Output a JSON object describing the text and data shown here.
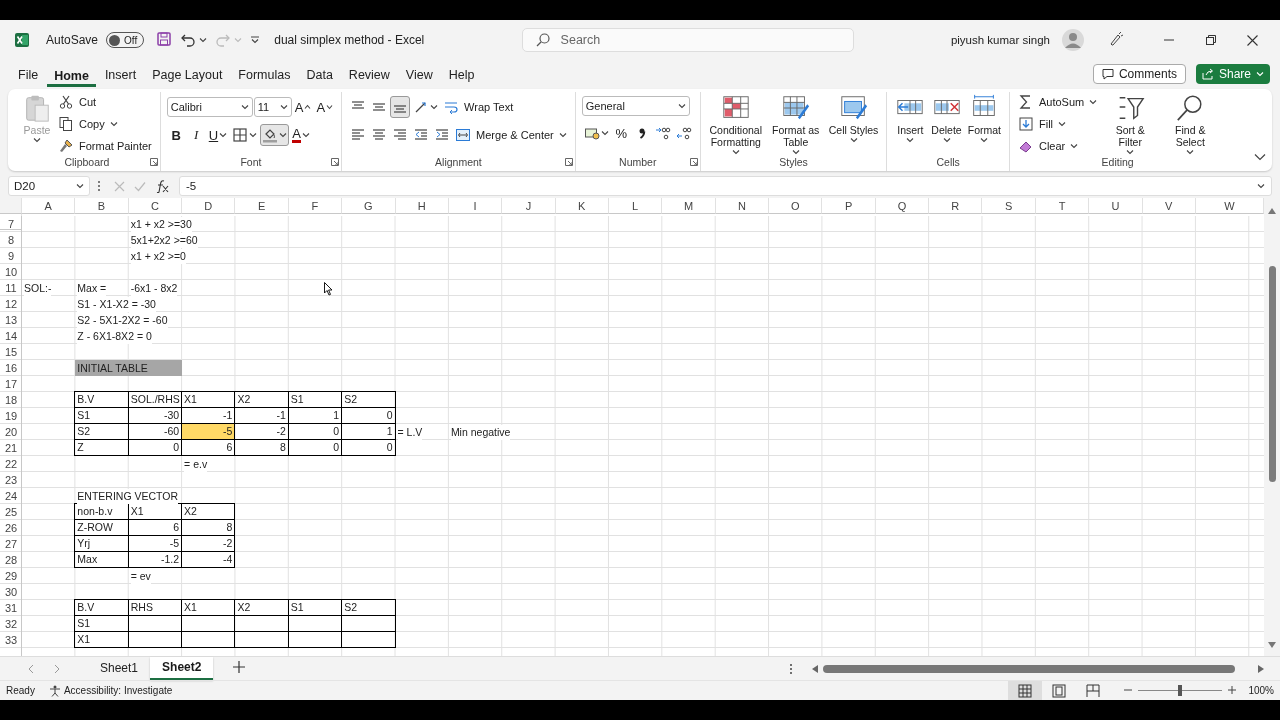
{
  "title_bar": {
    "autosave": {
      "label": "AutoSave",
      "on": false,
      "state_text": "Off"
    },
    "document_title": "dual simplex method  -  Excel",
    "search_placeholder": "Search",
    "user_name": "piyush kumar singh"
  },
  "menu_tabs": [
    {
      "label": "File",
      "selected": false
    },
    {
      "label": "Home",
      "selected": true
    },
    {
      "label": "Insert",
      "selected": false
    },
    {
      "label": "Page Layout",
      "selected": false
    },
    {
      "label": "Formulas",
      "selected": false
    },
    {
      "label": "Data",
      "selected": false
    },
    {
      "label": "Review",
      "selected": false
    },
    {
      "label": "View",
      "selected": false
    },
    {
      "label": "Help",
      "selected": false
    }
  ],
  "comments_button": "Comments",
  "share_button": "Share",
  "ribbon": [
    {
      "label": "Clipboard",
      "stacks": [
        [
          {
            "kind": "large",
            "label": "Paste",
            "disabled": true
          }
        ],
        [
          {
            "kind": "small",
            "label": "Cut",
            "disabled": false
          },
          {
            "kind": "small",
            "label": "Copy",
            "disabled": false
          },
          {
            "kind": "small",
            "label": "Format Painter",
            "disabled": false
          }
        ]
      ]
    },
    {
      "label": "Font",
      "upper_row": [
        {
          "kind": "field",
          "value": "Calibri"
        },
        {
          "kind": "field",
          "value": "11"
        },
        {
          "kind": "tool",
          "label": "A",
          "selected": false
        },
        {
          "kind": "tool",
          "label": "A",
          "selected": false
        }
      ],
      "lower_row": [
        {
          "kind": "tool",
          "label": "B",
          "selected": false
        },
        {
          "kind": "tool",
          "label": "I",
          "selected": false
        },
        {
          "kind": "tool",
          "label": "U",
          "selected": false
        },
        {
          "kind": "tool",
          "selected": false
        },
        {
          "kind": "tool",
          "selected": true
        },
        {
          "kind": "tool",
          "label": "A",
          "selected": false
        }
      ]
    },
    {
      "label": "Alignment",
      "upper_row": [
        {
          "kind": "tool",
          "selected": false
        },
        {
          "kind": "tool",
          "selected": false
        },
        {
          "kind": "tool",
          "selected": true
        },
        {
          "kind": "tool",
          "selected": false
        },
        {
          "kind": "small",
          "label": "Wrap Text"
        }
      ],
      "lower_row": [
        {
          "kind": "tool",
          "selected": false
        },
        {
          "kind": "tool",
          "selected": false
        },
        {
          "kind": "tool",
          "selected": false
        },
        {
          "kind": "tool",
          "selected": false
        },
        {
          "kind": "tool",
          "selected": false
        },
        {
          "kind": "small",
          "label": "Merge & Center"
        }
      ]
    },
    {
      "label": "Number",
      "upper_row": [
        {
          "kind": "field",
          "value": "General"
        }
      ],
      "lower_row": [
        {
          "kind": "tool",
          "selected": false
        },
        {
          "kind": "tool",
          "label": "%",
          "selected": false
        },
        {
          "kind": "tool",
          "selected": false
        },
        {
          "kind": "tool",
          "selected": false
        },
        {
          "kind": "tool",
          "selected": false
        }
      ]
    },
    {
      "label": "Styles",
      "stacks": [
        [
          {
            "kind": "large",
            "label": "Conditional Formatting"
          }
        ],
        [
          {
            "kind": "large",
            "label": "Format as Table"
          }
        ],
        [
          {
            "kind": "large",
            "label": "Cell Styles"
          }
        ]
      ]
    },
    {
      "label": "Cells",
      "stacks": [
        [
          {
            "kind": "large",
            "label": "Insert"
          }
        ],
        [
          {
            "kind": "large",
            "label": "Delete"
          }
        ],
        [
          {
            "kind": "large",
            "label": "Format"
          }
        ]
      ]
    },
    {
      "label": "Editing",
      "stacks": [
        [
          {
            "kind": "small",
            "label": "AutoSum"
          },
          {
            "kind": "small",
            "label": "Fill"
          },
          {
            "kind": "small",
            "label": "Clear"
          }
        ],
        [
          {
            "kind": "large",
            "label": "Sort & Filter"
          }
        ],
        [
          {
            "kind": "large",
            "label": "Find & Select"
          }
        ]
      ]
    }
  ],
  "formula_bar": {
    "name_box": "D20",
    "formula": "-5"
  },
  "grid": {
    "columns": [
      "A",
      "B",
      "C",
      "D",
      "E",
      "F",
      "G",
      "H",
      "I",
      "J",
      "K",
      "L",
      "M",
      "N",
      "O",
      "P",
      "Q",
      "R",
      "S",
      "T",
      "U",
      "V",
      "W"
    ],
    "rows": [
      {
        "num": "7",
        "cells": [
          {
            "kind": "blank",
            "bordered": false
          },
          {
            "kind": "blank",
            "bordered": false
          },
          {
            "kind": "text",
            "text": "x1 + x2 >=30",
            "bordered": false
          }
        ]
      },
      {
        "num": "8",
        "cells": [
          {
            "kind": "blank",
            "bordered": false
          },
          {
            "kind": "blank",
            "bordered": false
          },
          {
            "kind": "text",
            "text": "5x1+2x2 >=60",
            "bordered": false
          }
        ]
      },
      {
        "num": "9",
        "cells": [
          {
            "kind": "blank",
            "bordered": false
          },
          {
            "kind": "blank",
            "bordered": false
          },
          {
            "kind": "text",
            "text": "x1 + x2 >=0",
            "bordered": false
          }
        ]
      },
      {
        "num": "10"
      },
      {
        "num": "11",
        "cells": [
          {
            "kind": "text",
            "text": "SOL:-",
            "bordered": false
          },
          {
            "kind": "text",
            "text": "Max =",
            "bordered": false
          },
          {
            "kind": "text",
            "text": " -6x1 - 8x2",
            "bordered": false
          }
        ]
      },
      {
        "num": "12",
        "cells": [
          {
            "kind": "blank",
            "bordered": false
          },
          {
            "kind": "text",
            "text": "S1 - X1-X2 = -30",
            "bordered": false
          }
        ]
      },
      {
        "num": "13",
        "cells": [
          {
            "kind": "blank",
            "bordered": false
          },
          {
            "kind": "text",
            "text": "S2 - 5X1-2X2 = -60",
            "bordered": false
          }
        ]
      },
      {
        "num": "14",
        "cells": [
          {
            "kind": "blank",
            "bordered": false
          },
          {
            "kind": "text",
            "text": "Z - 6X1-8X2 = 0",
            "bordered": false
          }
        ]
      },
      {
        "num": "15"
      },
      {
        "num": "16",
        "cells": [
          {
            "kind": "blank",
            "bordered": false
          },
          {
            "kind": "text",
            "text": "INITIAL TABLE",
            "bordered": false,
            "color": "#a6a6a6"
          },
          {
            "kind": "blank",
            "bordered": false,
            "color": "#a6a6a6"
          }
        ]
      },
      {
        "num": "17"
      },
      {
        "num": "18",
        "cells": [
          {
            "kind": "blank",
            "bordered": false
          },
          {
            "kind": "text",
            "text": "B.V",
            "bordered": true
          },
          {
            "kind": "text",
            "text": "SOL./RHS",
            "bordered": true
          },
          {
            "kind": "text",
            "text": "X1",
            "bordered": true
          },
          {
            "kind": "text",
            "text": "X2",
            "bordered": true
          },
          {
            "kind": "text",
            "text": "S1",
            "bordered": true
          },
          {
            "kind": "text",
            "text": "S2",
            "bordered": true
          }
        ]
      },
      {
        "num": "19",
        "cells": [
          {
            "kind": "blank",
            "bordered": false
          },
          {
            "kind": "text",
            "text": "S1",
            "bordered": true
          },
          {
            "kind": "number",
            "text": "-30",
            "bordered": true
          },
          {
            "kind": "number",
            "text": "-1",
            "bordered": true
          },
          {
            "kind": "number",
            "text": "-1",
            "bordered": true
          },
          {
            "kind": "number",
            "text": "1",
            "bordered": true
          },
          {
            "kind": "number",
            "text": "0",
            "bordered": true
          }
        ]
      },
      {
        "num": "20",
        "cells": [
          {
            "kind": "blank",
            "bordered": false
          },
          {
            "kind": "text",
            "text": "S2",
            "bordered": true
          },
          {
            "kind": "number",
            "text": "-60",
            "bordered": true
          },
          {
            "kind": "number",
            "text": "-5",
            "bordered": true,
            "color": "#ffd966"
          },
          {
            "kind": "number",
            "text": "-2",
            "bordered": true
          },
          {
            "kind": "number",
            "text": "0",
            "bordered": true
          },
          {
            "kind": "number",
            "text": "1",
            "bordered": true
          },
          {
            "kind": "text",
            "text": "= L.V",
            "bordered": false
          },
          {
            "kind": "text",
            "text": "Min negative",
            "bordered": false
          }
        ]
      },
      {
        "num": "21",
        "cells": [
          {
            "kind": "blank",
            "bordered": false
          },
          {
            "kind": "text",
            "text": "Z",
            "bordered": true
          },
          {
            "kind": "number",
            "text": "0",
            "bordered": true
          },
          {
            "kind": "number",
            "text": "6",
            "bordered": true
          },
          {
            "kind": "number",
            "text": "8",
            "bordered": true
          },
          {
            "kind": "number",
            "text": "0",
            "bordered": true
          },
          {
            "kind": "number",
            "text": "0",
            "bordered": true
          }
        ]
      },
      {
        "num": "22",
        "cells": [
          {
            "kind": "blank",
            "bordered": false
          },
          {
            "kind": "blank",
            "bordered": false
          },
          {
            "kind": "blank",
            "bordered": false
          },
          {
            "kind": "text",
            "text": "= e.v",
            "bordered": false
          }
        ]
      },
      {
        "num": "23"
      },
      {
        "num": "24",
        "cells": [
          {
            "kind": "blank",
            "bordered": false
          },
          {
            "kind": "text",
            "text": "ENTERING VECTOR",
            "bordered": false
          }
        ]
      },
      {
        "num": "25",
        "cells": [
          {
            "kind": "blank",
            "bordered": false
          },
          {
            "kind": "text",
            "text": "non-b.v",
            "bordered": true
          },
          {
            "kind": "text",
            "text": "X1",
            "bordered": true
          },
          {
            "kind": "text",
            "text": "X2",
            "bordered": true
          }
        ]
      },
      {
        "num": "26",
        "cells": [
          {
            "kind": "blank",
            "bordered": false
          },
          {
            "kind": "text",
            "text": "Z-ROW",
            "bordered": true
          },
          {
            "kind": "number",
            "text": "6",
            "bordered": true
          },
          {
            "kind": "number",
            "text": "8",
            "bordered": true
          }
        ]
      },
      {
        "num": "27",
        "cells": [
          {
            "kind": "blank",
            "bordered": false
          },
          {
            "kind": "text",
            "text": "Yrj",
            "bordered": true
          },
          {
            "kind": "number",
            "text": "-5",
            "bordered": true
          },
          {
            "kind": "number",
            "text": "-2",
            "bordered": true
          }
        ]
      },
      {
        "num": "28",
        "cells": [
          {
            "kind": "blank",
            "bordered": false
          },
          {
            "kind": "text",
            "text": "Max",
            "bordered": true
          },
          {
            "kind": "number",
            "text": "-1.2",
            "bordered": true
          },
          {
            "kind": "number",
            "text": "-4",
            "bordered": true
          }
        ]
      },
      {
        "num": "29",
        "cells": [
          {
            "kind": "blank",
            "bordered": false
          },
          {
            "kind": "blank",
            "bordered": false
          },
          {
            "kind": "text",
            "text": "= ev",
            "bordered": false
          }
        ]
      },
      {
        "num": "30"
      },
      {
        "num": "31",
        "cells": [
          {
            "kind": "blank",
            "bordered": false
          },
          {
            "kind": "text",
            "text": "B.V",
            "bordered": true
          },
          {
            "kind": "text",
            "text": "RHS",
            "bordered": true
          },
          {
            "kind": "text",
            "text": "X1",
            "bordered": true
          },
          {
            "kind": "text",
            "text": "X2",
            "bordered": true
          },
          {
            "kind": "text",
            "text": "S1",
            "bordered": true
          },
          {
            "kind": "text",
            "text": "S2",
            "bordered": true
          }
        ]
      },
      {
        "num": "32",
        "cells": [
          {
            "kind": "blank",
            "bordered": false
          },
          {
            "kind": "text",
            "text": "S1",
            "bordered": true
          },
          {
            "kind": "blank",
            "bordered": true
          },
          {
            "kind": "blank",
            "bordered": true
          },
          {
            "kind": "blank",
            "bordered": true
          },
          {
            "kind": "blank",
            "bordered": true
          },
          {
            "kind": "blank",
            "bordered": true
          }
        ]
      },
      {
        "num": "33",
        "cells": [
          {
            "kind": "blank",
            "bordered": false
          },
          {
            "kind": "text",
            "text": "X1",
            "bordered": true
          },
          {
            "kind": "blank",
            "bordered": true
          },
          {
            "kind": "blank",
            "bordered": true
          },
          {
            "kind": "blank",
            "bordered": true
          },
          {
            "kind": "blank",
            "bordered": true
          },
          {
            "kind": "blank",
            "bordered": true
          }
        ]
      }
    ]
  },
  "sheet_tabs": [
    {
      "label": "Sheet1",
      "selected": false
    },
    {
      "label": "Sheet2",
      "selected": true
    }
  ],
  "status_bar": {
    "ready": "Ready",
    "accessibility": "Accessibility: Investigate",
    "views": [
      {
        "selected": true
      },
      {
        "selected": false
      },
      {
        "selected": false
      }
    ],
    "zoom": {
      "level": 0.5,
      "reading": "100%"
    }
  }
}
